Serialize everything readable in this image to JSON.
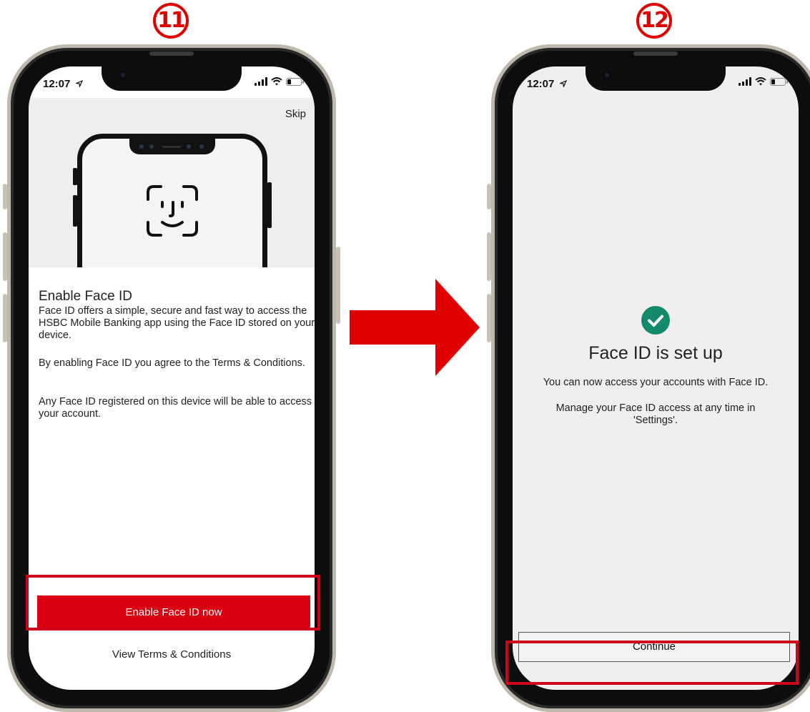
{
  "steps": {
    "left_number": "11",
    "right_number": "12"
  },
  "status_bar": {
    "time": "12:07"
  },
  "icons": {
    "location": "location-arrow-icon",
    "signal": "cellular-signal-icon",
    "wifi": "wifi-icon",
    "battery": "battery-icon",
    "face_id": "face-id-icon",
    "check": "checkmark-circle-icon",
    "arrow": "right-arrow-icon"
  },
  "enable_screen": {
    "skip_label": "Skip",
    "title": "Enable Face ID",
    "paragraph_1": "Face ID offers a simple, secure and fast way to access the HSBC Mobile Banking app using the Face ID stored on your device.",
    "paragraph_2": "By enabling Face ID you agree to the Terms & Conditions.",
    "paragraph_3": "Any  Face ID registered on this device will be able to access your account.",
    "primary_button_label": "Enable Face ID now",
    "terms_link_label": "View Terms & Conditions"
  },
  "success_screen": {
    "title": "Face ID is set up",
    "message_1": "You can now access your accounts with Face ID.",
    "message_2": "Manage your Face ID access at any time in 'Settings'.",
    "continue_label": "Continue"
  },
  "colors": {
    "hsbc_red": "#db0011",
    "highlight_red": "#d0021b",
    "success_green": "#138a6c",
    "arrow_red": "#e00000"
  }
}
